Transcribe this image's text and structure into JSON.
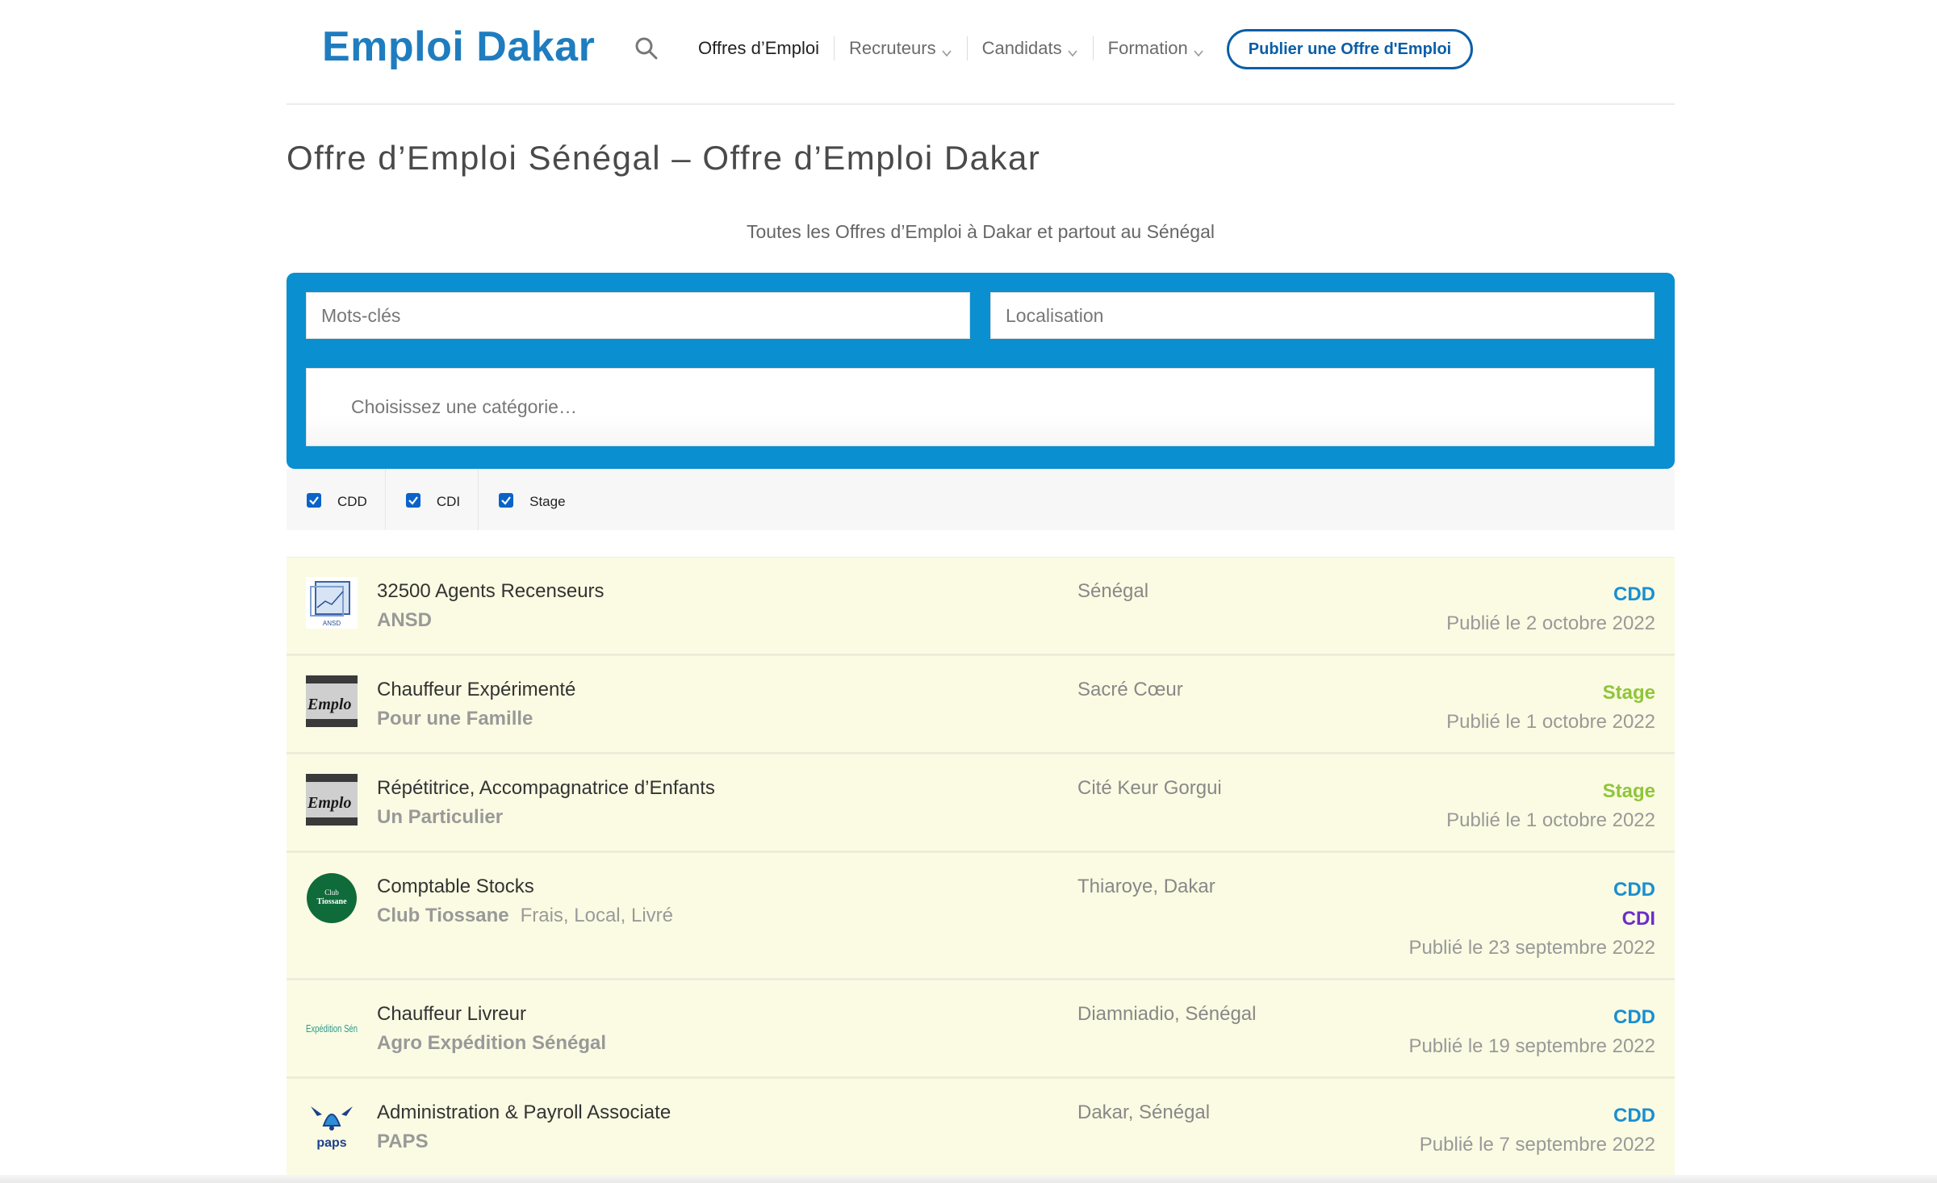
{
  "header": {
    "logo": "Emploi Dakar",
    "nav": [
      {
        "label": "Offres d’Emploi",
        "dropdown": false
      },
      {
        "label": "Recruteurs",
        "dropdown": true
      },
      {
        "label": "Candidats",
        "dropdown": true
      },
      {
        "label": "Formation",
        "dropdown": true
      }
    ],
    "publish_button": "Publier une Offre d'Emploi"
  },
  "page": {
    "title": "Offre d’Emploi Sénégal – Offre d’Emploi Dakar",
    "subtitle": "Toutes les Offres d’Emploi à Dakar et partout au Sénégal"
  },
  "search": {
    "keywords_placeholder": "Mots-clés",
    "location_placeholder": "Localisation",
    "category_placeholder": "Choisissez une catégorie…"
  },
  "filters": [
    {
      "label": "CDD",
      "checked": true
    },
    {
      "label": "CDI",
      "checked": true
    },
    {
      "label": "Stage",
      "checked": true
    }
  ],
  "jobs": [
    {
      "title": "32500 Agents Recenseurs",
      "company": "ANSD",
      "tagline": "",
      "location": "Sénégal",
      "types": [
        "CDD"
      ],
      "date": "Publié le 2 octobre 2022",
      "logo": "ansd-logo"
    },
    {
      "title": "Chauffeur Expérimenté",
      "company": "Pour une Famille",
      "tagline": "",
      "location": "Sacré Cœur",
      "types": [
        "Stage"
      ],
      "date": "Publié le 1 octobre 2022",
      "logo": "emploi-logo"
    },
    {
      "title": "Répétitrice, Accompagnatrice d’Enfants",
      "company": "Un Particulier",
      "tagline": "",
      "location": "Cité Keur Gorgui",
      "types": [
        "Stage"
      ],
      "date": "Publié le 1 octobre 2022",
      "logo": "emploi-logo"
    },
    {
      "title": "Comptable Stocks",
      "company": "Club Tiossane",
      "tagline": "Frais, Local, Livré",
      "location": "Thiaroye, Dakar",
      "types": [
        "CDD",
        "CDI"
      ],
      "date": "Publié le 23 septembre 2022",
      "logo": "club-tiossane-logo"
    },
    {
      "title": "Chauffeur Livreur",
      "company": "Agro Expédition Sénégal",
      "tagline": "",
      "location": "Diamniadio, Sénégal",
      "types": [
        "CDD"
      ],
      "date": "Publié le 19 septembre 2022",
      "logo": "expedition-logo"
    },
    {
      "title": "Administration & Payroll Associate",
      "company": "PAPS",
      "tagline": "",
      "location": "Dakar, Sénégal",
      "types": [
        "CDD"
      ],
      "date": "Publié le 7 septembre 2022",
      "logo": "paps-logo"
    }
  ],
  "logo_text": {
    "ansd": "ANSD",
    "emploi": "Emplo",
    "club_line1": "Club",
    "club_line2": "Tiossane",
    "expedition": "Expédition Sén",
    "paps": "paps"
  },
  "colors": {
    "brand": "#1f7dbf",
    "search_panel": "#0a8fd0",
    "listing_bg": "#fbfbe3",
    "cdd": "#1a8fd0",
    "stage": "#8fc53a",
    "cdi": "#6a2fc7"
  }
}
